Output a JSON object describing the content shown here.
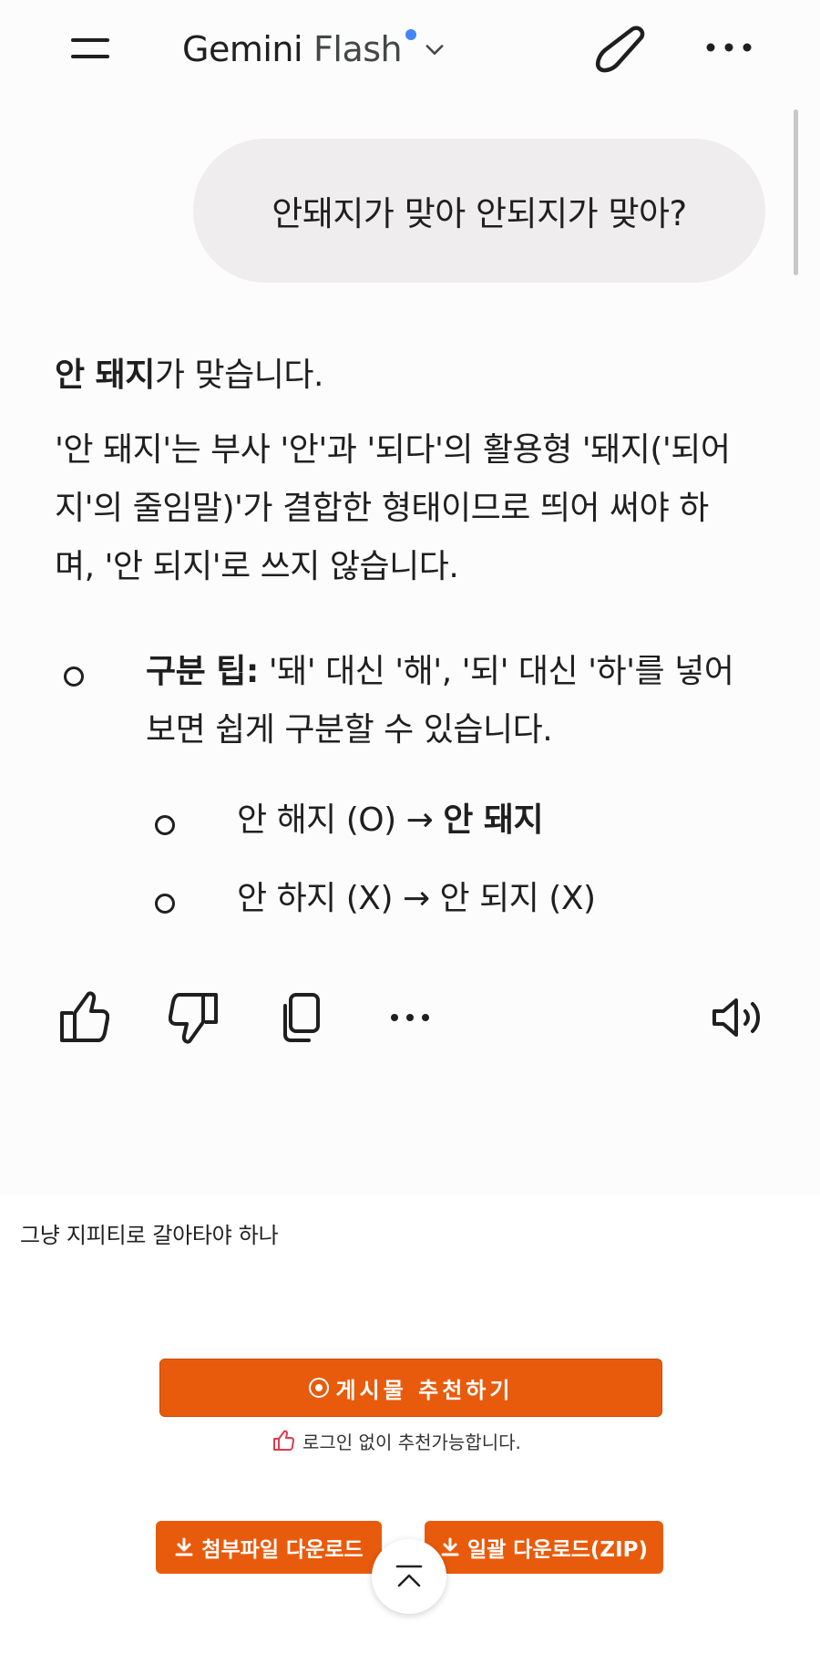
{
  "app": {
    "model_name": "Gemini",
    "model_variant": "Flash",
    "icons": {
      "menu": "menu-icon",
      "dropdown": "chevron-down-icon",
      "new_chat": "edit-icon",
      "more": "more-horizontal-icon"
    }
  },
  "conversation": {
    "user_prompt": "안돼지가 맞아 안되지가 맞아?",
    "answer": {
      "intro_bold": "안 돼지",
      "intro_rest": "가 맞습니다.",
      "explanation": "'안 돼지'는 부사 '안'과 '되다'의 활용형 '돼지('되어지'의 줄임말)'가 결합한 형태이므로 띄어 써야 하며, '안 되지'로 쓰지 않습니다.",
      "tip_label": "구분 팁:",
      "tip_text": " '돼' 대신 '해', '되' 대신 '하'를 넣어보면 쉽게 구분할 수 있습니다.",
      "example1_prefix": "안 해지 (O) → ",
      "example1_bold": "안 돼지",
      "example2": "안 하지 (X) → 안 되지 (X)"
    },
    "actions": [
      "thumbs-up-icon",
      "thumbs-down-icon",
      "copy-icon",
      "more-horizontal-icon",
      "speaker-icon"
    ]
  },
  "post": {
    "comment": "그냥 지피티로 갈아타야 하나",
    "recommend_label": "게시물 추천하기",
    "recommend_note": "로그인 없이 추천가능합니다.",
    "download_label": "첨부파일 다운로드",
    "download_zip_label": "일괄 다운로드(ZIP)"
  },
  "colors": {
    "accent_dot": "#4285f4",
    "button_orange": "#e95b0c",
    "bubble_bg": "#efeded"
  }
}
